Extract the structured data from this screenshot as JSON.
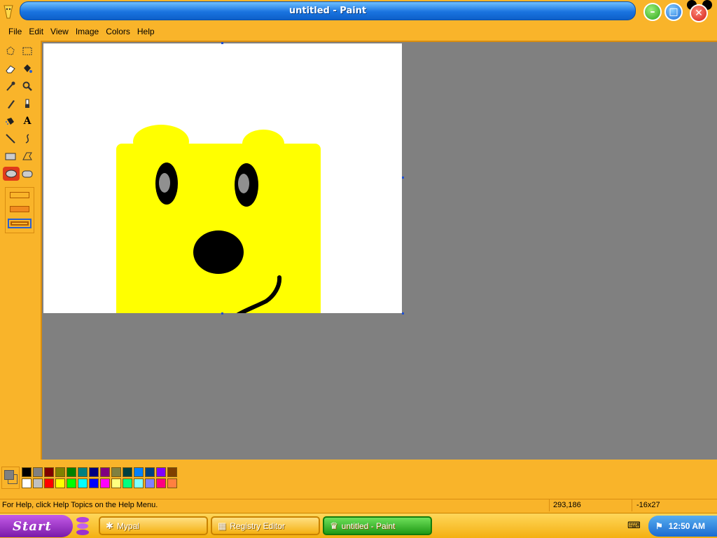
{
  "window": {
    "title": "untitled - Paint"
  },
  "menu": [
    "File",
    "Edit",
    "View",
    "Image",
    "Colors",
    "Help"
  ],
  "tools": [
    {
      "name": "free-form-select-icon"
    },
    {
      "name": "rect-select-icon"
    },
    {
      "name": "eraser-icon"
    },
    {
      "name": "fill-bucket-icon"
    },
    {
      "name": "color-picker-icon"
    },
    {
      "name": "magnifier-icon"
    },
    {
      "name": "pencil-icon"
    },
    {
      "name": "brush-icon"
    },
    {
      "name": "airbrush-icon"
    },
    {
      "name": "text-tool-icon",
      "glyph": "A"
    },
    {
      "name": "line-icon"
    },
    {
      "name": "curve-icon"
    },
    {
      "name": "rectangle-icon"
    },
    {
      "name": "polygon-icon"
    },
    {
      "name": "ellipse-icon",
      "selected": true
    },
    {
      "name": "rounded-rect-icon"
    }
  ],
  "palette": {
    "top": [
      "#000000",
      "#808080",
      "#800000",
      "#808000",
      "#008000",
      "#008080",
      "#000080",
      "#800080",
      "#808040",
      "#004040",
      "#0080ff",
      "#004080",
      "#8000ff",
      "#804000"
    ],
    "bottom": [
      "#ffffff",
      "#c0c0c0",
      "#ff0000",
      "#ffff00",
      "#00ff00",
      "#00ffff",
      "#0000ff",
      "#ff00ff",
      "#ffff80",
      "#00ff80",
      "#80ffff",
      "#8080ff",
      "#ff0080",
      "#ff8040"
    ],
    "foreground": "#808080",
    "background": "#f9b42a"
  },
  "status": {
    "help": "For Help, click Help Topics on the Help Menu.",
    "coords": "293,186",
    "size": "-16x27"
  },
  "taskbar": {
    "start": "Start",
    "buttons": [
      {
        "label": "Mypal"
      },
      {
        "label": "Registry Editor"
      },
      {
        "label": "untitled - Paint",
        "active": true
      }
    ],
    "clock": "12:50 AM"
  }
}
